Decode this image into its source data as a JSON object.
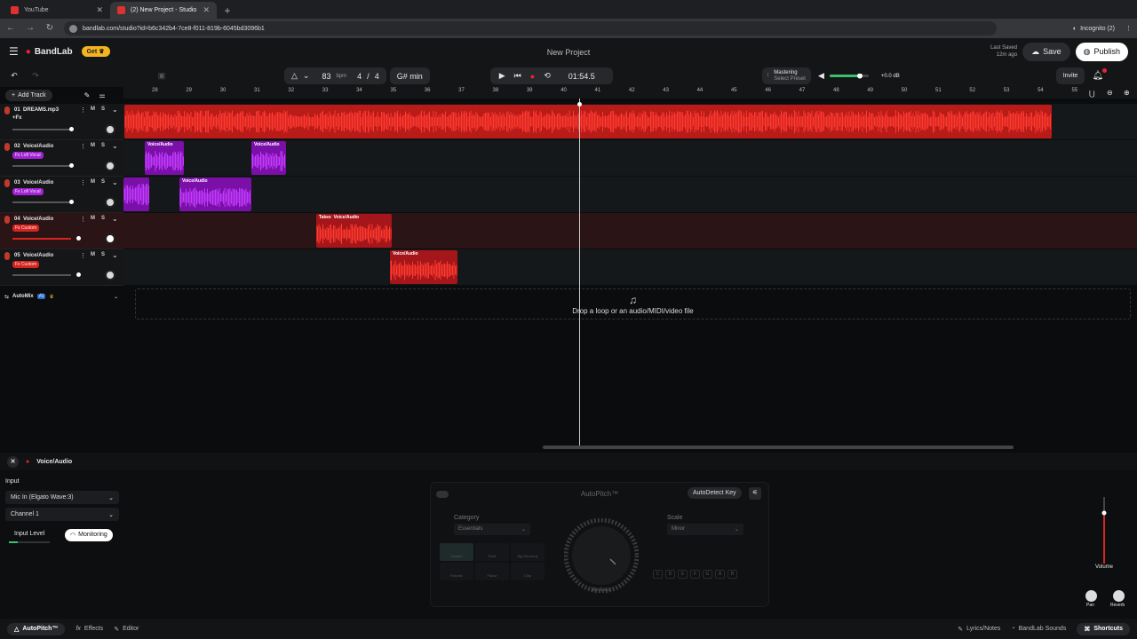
{
  "browser": {
    "tabs": [
      {
        "label": "YouTube"
      },
      {
        "label": "(2) New Project - Studio"
      }
    ],
    "url": "bandlab.com/studio?id=b6c342b4-7ce8-f011-819b-6045bd3096b1",
    "incognito": "Incognito (2)"
  },
  "app": {
    "logo": "BandLab",
    "get": "Get",
    "project_title": "New Project",
    "last_saved": "Last Saved",
    "last_saved_time": "12m ago",
    "save": "Save",
    "publish": "Publish",
    "invite": "Invite"
  },
  "transport": {
    "bpm": "83",
    "bpm_unit": "bpm",
    "time_sig_num": "4",
    "time_sig_sep": "/",
    "time_sig_den": "4",
    "key": "G# min",
    "time": "01:54.5",
    "mastering": "Mastering",
    "mastering_preset": "Select Preset",
    "gain": "+0.0 dB"
  },
  "sidebar": {
    "add_track": "Add Track",
    "automix": "AutoMix",
    "automix_badge": "AI",
    "m": "M",
    "s": "S"
  },
  "tracks": [
    {
      "num": "01",
      "name": "DREAMS.mp3",
      "tag": "+Fx"
    },
    {
      "num": "02",
      "name": "Voice/Audio",
      "tag": "Fx Lofi Vocal"
    },
    {
      "num": "03",
      "name": "Voice/Audio",
      "tag": "Fx Lofi Vocal"
    },
    {
      "num": "04",
      "name": "Voice/Audio",
      "tag": "Fx Custom"
    },
    {
      "num": "05",
      "name": "Voice/Audio",
      "tag": "Fx Custom"
    }
  ],
  "ruler": [
    "28",
    "29",
    "30",
    "31",
    "32",
    "33",
    "34",
    "35",
    "36",
    "37",
    "38",
    "39",
    "40",
    "41",
    "42",
    "43",
    "44",
    "45",
    "46",
    "47",
    "48",
    "49",
    "50",
    "51",
    "52",
    "53",
    "54",
    "55"
  ],
  "clips": {
    "voice": "Voice/Audio",
    "takes": "Takes"
  },
  "drop_text": "Drop a loop or an audio/MIDI/video file",
  "panel": {
    "title": "Voice/Audio",
    "input_label": "Input",
    "input_device": "Mic In (Elgato Wave:3)",
    "channel": "Channel 1",
    "input_level": "Input Level",
    "monitoring": "Monitoring",
    "autopitch": {
      "title": "AutoPitch™",
      "autodetect": "AutoDetect Key",
      "category_label": "Category",
      "category": "Essentials",
      "scale_label": "Scale",
      "scale": "Minor",
      "knob_label": "Mediator",
      "presets": [
        "Classic",
        "Duet",
        "Big Harmony",
        "Robotic",
        "Flavor",
        "Chip"
      ],
      "notes": [
        "C",
        "D",
        "E",
        "F",
        "G",
        "A",
        "B"
      ]
    },
    "volume": "Volume",
    "pan": "Pan",
    "reverb": "Reverb"
  },
  "bottom_tabs": {
    "autopitch": "AutoPitch™",
    "effects": "Effects",
    "editor": "Editor",
    "lyrics": "Lyrics/Notes",
    "sounds": "BandLab Sounds",
    "shortcuts": "Shortcuts"
  },
  "colors": {
    "accent_red": "#d8231f",
    "purple": "#a321d6",
    "dark": "#0b0c0d"
  }
}
